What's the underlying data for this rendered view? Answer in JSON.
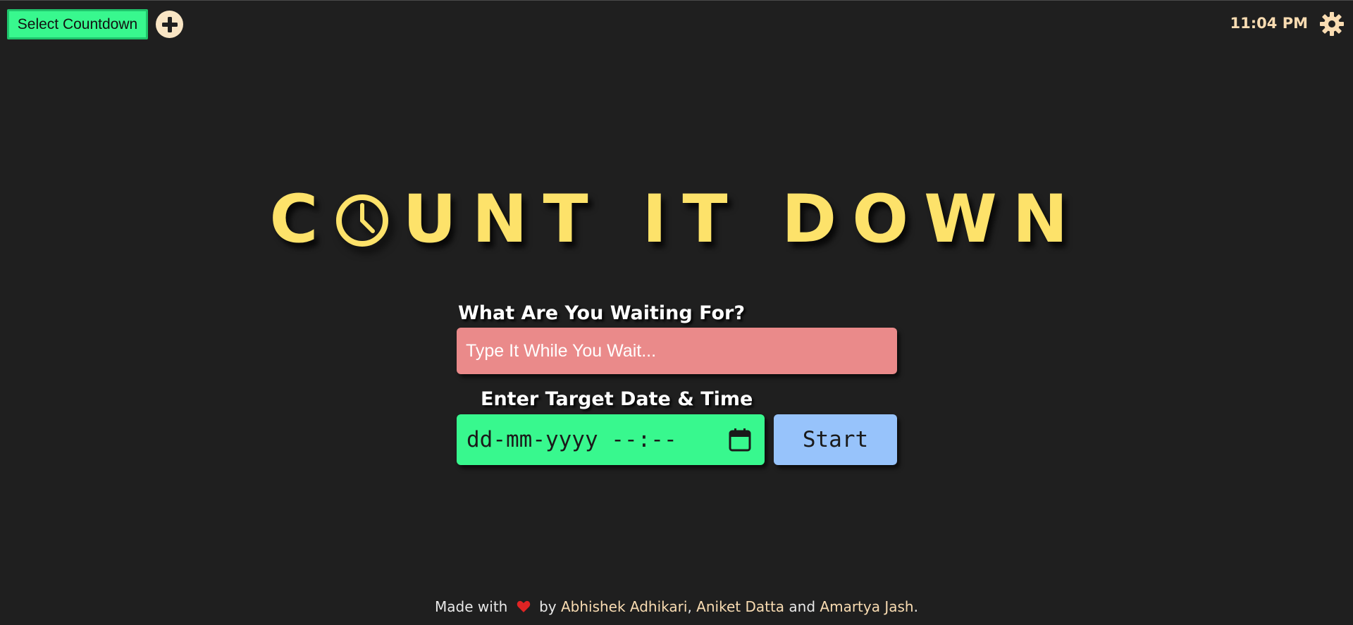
{
  "topbar": {
    "select_label": "Select Countdown",
    "add_icon": "plus-circle-icon",
    "time": "11:04 PM",
    "settings_icon": "gear-icon"
  },
  "title": {
    "prefix": "C",
    "suffix": "UNT IT DOWN",
    "o_icon": "clock-icon"
  },
  "form": {
    "event_label": "What Are You Waiting For?",
    "event_placeholder": "Type It While You Wait...",
    "date_label": "Enter Target Date & Time",
    "date_placeholder": "dd-mm-yyyy --:--",
    "calendar_icon": "calendar-icon",
    "start_label": "Start"
  },
  "footer": {
    "made_with": "Made with",
    "heart_icon": "heart-icon",
    "by": "by",
    "author1": "Abhishek Adhikari",
    "sep": ",",
    "author2": "Aniket Datta",
    "and": "and",
    "author3": "Amartya Jash",
    "end": "."
  },
  "colors": {
    "background": "#1f1f1f",
    "title": "#fde26a",
    "select_button": "#38f88e",
    "event_input": "#ea8a8a",
    "date_input": "#38f88e",
    "start_button": "#97c3fb",
    "accent_text": "#f9dcb2",
    "heart": "#e02424"
  }
}
